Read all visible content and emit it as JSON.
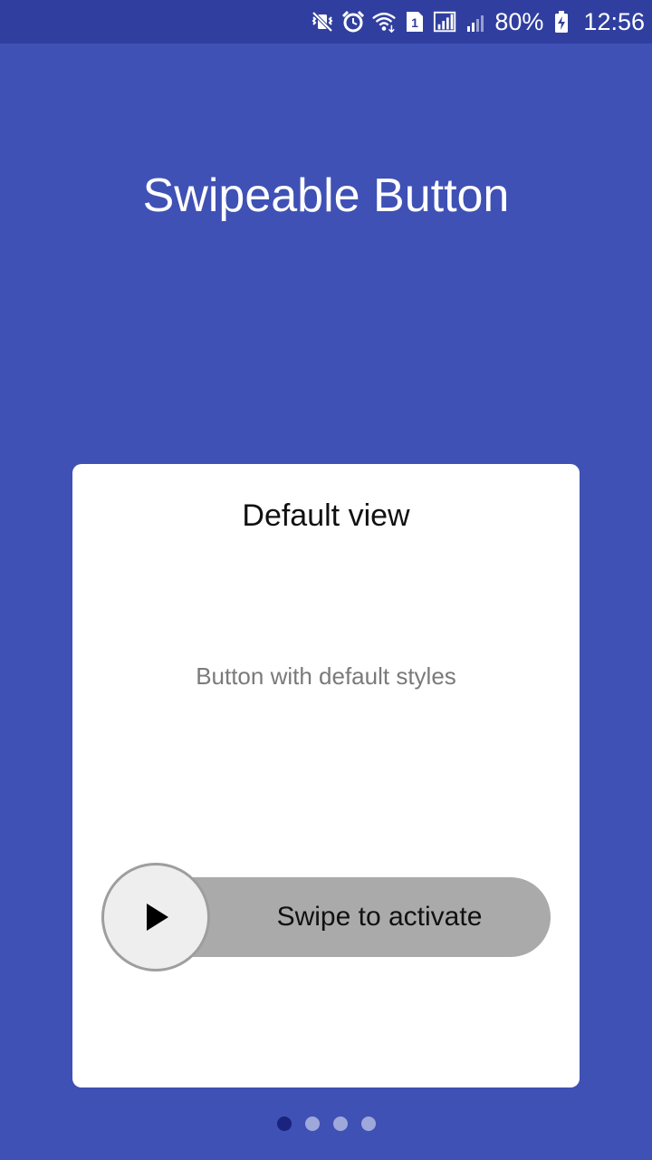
{
  "status_bar": {
    "battery": "80%",
    "time": "12:56",
    "sim_slot": "1",
    "icons": [
      "mute-vibrate-icon",
      "alarm-icon",
      "wifi-icon",
      "sim-icon",
      "signal-icon",
      "signal-weak-icon",
      "battery-charging-icon"
    ]
  },
  "app": {
    "title": "Swipeable Button"
  },
  "card": {
    "title": "Default view",
    "subtitle": "Button with default styles"
  },
  "swipe_button": {
    "label": "Swipe to activate",
    "icon": "play-icon"
  },
  "pager": {
    "pages": 4,
    "current": 1
  },
  "colors": {
    "background": "#3f51b5",
    "status_bar": "#303f9f",
    "card": "#ffffff",
    "track": "#aaaaaa",
    "thumb": "#eeeeee",
    "dot_active": "#1a237e",
    "dot_inactive": "#9fa8da"
  }
}
